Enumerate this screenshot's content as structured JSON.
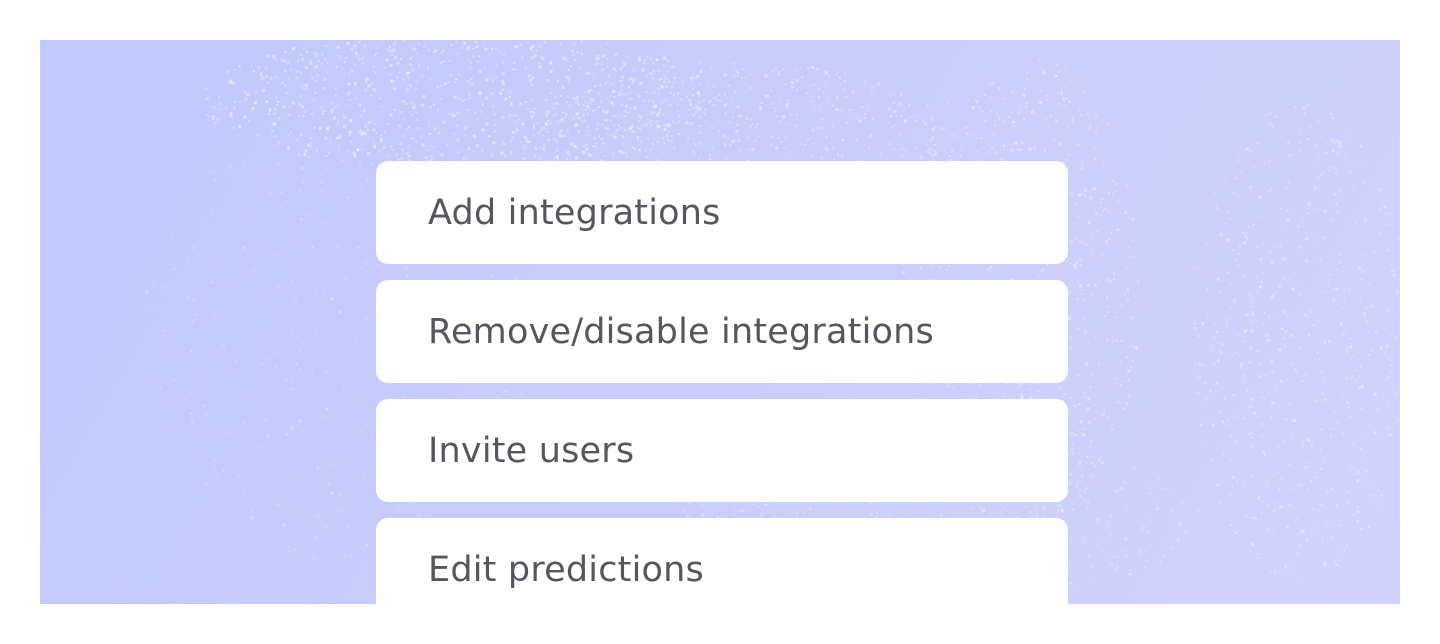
{
  "permissions_list": {
    "items": [
      {
        "label": "Add integrations"
      },
      {
        "label": "Remove/disable integrations"
      },
      {
        "label": "Invite users"
      },
      {
        "label": "Edit predictions"
      }
    ]
  },
  "colors": {
    "background_gradient_start": "#c0c8fc",
    "background_gradient_end": "#d2d3fd",
    "card_background": "#ffffff",
    "label_text": "#56575e"
  }
}
